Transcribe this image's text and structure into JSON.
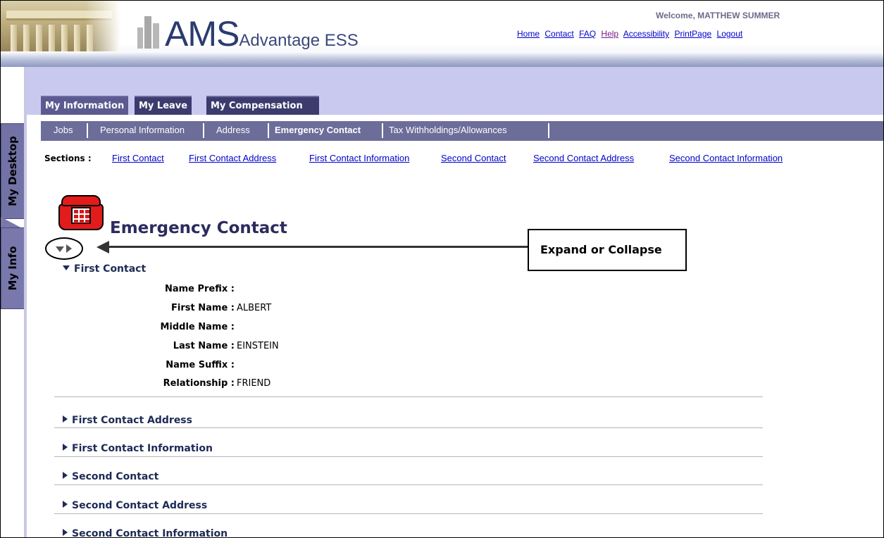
{
  "header": {
    "logo_main": "AMS",
    "logo_sub": "Advantage ESS",
    "welcome": "Welcome, MATTHEW SUMMER",
    "links": [
      "Home",
      "Contact",
      "FAQ",
      "Help",
      "Accessibility",
      "PrintPage",
      "Logout"
    ]
  },
  "side_tabs": {
    "desktop": "My Desktop",
    "info": "My Info"
  },
  "main_tabs": [
    "My Information",
    "My Leave",
    "My Compensation"
  ],
  "sub_nav": [
    "Jobs",
    "Personal Information",
    "Address",
    "Emergency Contact",
    "Tax Withholdings/Allowances"
  ],
  "sections_bar": {
    "label": "Sections :",
    "links": [
      "First Contact",
      "First Contact Address",
      "First Contact Information",
      "Second Contact",
      "Second Contact Address",
      "Second Contact Information"
    ]
  },
  "page": {
    "title": "Emergency Contact",
    "callout": "Expand or Collapse"
  },
  "first_contact": {
    "title": "First Contact",
    "fields": [
      {
        "label": "Name Prefix :",
        "value": ""
      },
      {
        "label": "First Name :",
        "value": "ALBERT"
      },
      {
        "label": "Middle Name :",
        "value": ""
      },
      {
        "label": "Last Name :",
        "value": "EINSTEIN"
      },
      {
        "label": "Name Suffix :",
        "value": ""
      },
      {
        "label": "Relationship :",
        "value": "FRIEND"
      }
    ]
  },
  "collapsed_sections": [
    "First Contact Address",
    "First Contact Information",
    "Second Contact",
    "Second Contact Address",
    "Second Contact Information"
  ],
  "colors": {
    "nav_dark": "#3b3b6e",
    "nav_sub": "#6d6d9a",
    "tab_strip": "#c9c9f0",
    "link": "#0000cc",
    "heading": "#2b2b5e"
  }
}
